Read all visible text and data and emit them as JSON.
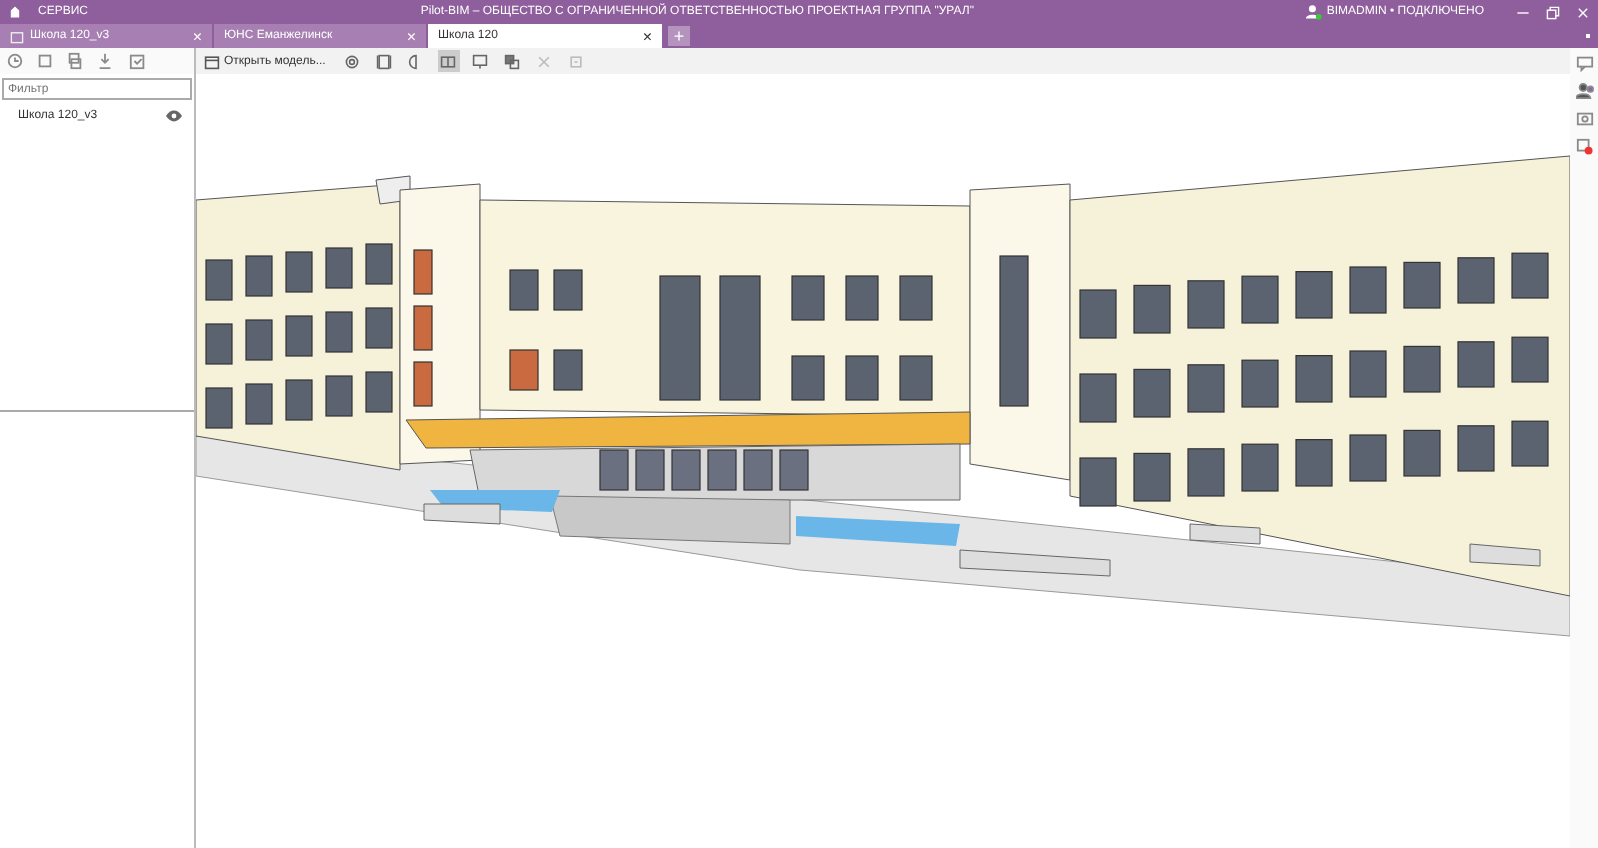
{
  "title_bar": {
    "menu": "СЕРВИС",
    "title": "Pilot-BIM – ОБЩЕСТВО С ОГРАНИЧЕННОЙ ОТВЕТСТВЕННОСТЬЮ ПРОЕКТНАЯ ГРУППА \"УРАЛ\"",
    "user": "BIMADMIN • ПОДКЛЮЧЕНО"
  },
  "tabs": [
    {
      "label": "Школа 120_v3",
      "close": "×",
      "selected": false
    },
    {
      "label": "ЮНС Еманжелинск",
      "close": "×",
      "selected": false
    },
    {
      "label": "Школа 120",
      "close": "×",
      "selected": true
    }
  ],
  "new_tab": "+",
  "sidebar": {
    "filter": {
      "placeholder": "Фильтр"
    },
    "items": [
      {
        "label": "Школа 120_v3",
        "visible": true
      }
    ]
  },
  "viewer_toolbar": {
    "open_model": "Открыть модель...",
    "tools": [
      {
        "selected": false
      },
      {
        "selected": false
      },
      {
        "selected": false
      },
      {
        "selected": true
      },
      {
        "selected": false
      },
      {
        "selected": false
      },
      {
        "selected": false
      },
      {
        "selected": false
      }
    ]
  }
}
